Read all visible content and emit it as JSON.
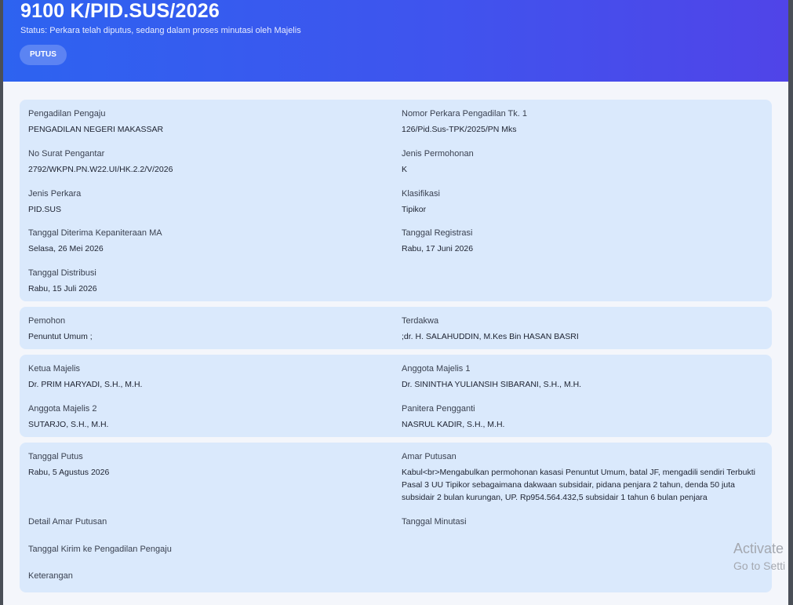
{
  "header": {
    "case_number": "9100 K/PID.SUS/2026",
    "status": "Status: Perkara telah diputus, sedang dalam proses minutasi oleh Majelis",
    "badge": "PUTUS"
  },
  "case_info": {
    "pengadilan_pengaju": {
      "label": "Pengadilan Pengaju",
      "value": "PENGADILAN NEGERI MAKASSAR"
    },
    "nomor_perkara_tk1": {
      "label": "Nomor Perkara Pengadilan Tk. 1",
      "value": "126/Pid.Sus-TPK/2025/PN Mks"
    },
    "no_surat_pengantar": {
      "label": "No Surat Pengantar",
      "value": "2792/WKPN.PN.W22.UI/HK.2.2/V/2026"
    },
    "jenis_permohonan": {
      "label": "Jenis Permohonan",
      "value": "K"
    },
    "jenis_perkara": {
      "label": "Jenis Perkara",
      "value": "PID.SUS"
    },
    "klasifikasi": {
      "label": "Klasifikasi",
      "value": "Tipikor"
    },
    "tanggal_diterima": {
      "label": "Tanggal Diterima Kepaniteraan MA",
      "value": "Selasa, 26 Mei 2026"
    },
    "tanggal_registrasi": {
      "label": "Tanggal Registrasi",
      "value": "Rabu, 17 Juni 2026"
    },
    "tanggal_distribusi": {
      "label": "Tanggal Distribusi",
      "value": "Rabu, 15 Juli 2026"
    }
  },
  "parties": {
    "pemohon": {
      "label": "Pemohon",
      "value": "Penuntut Umum ;"
    },
    "terdakwa": {
      "label": "Terdakwa",
      "value": ";dr. H. SALAHUDDIN, M.Kes Bin HASAN BASRI"
    }
  },
  "panel": {
    "ketua_majelis": {
      "label": "Ketua Majelis",
      "value": "Dr. PRIM HARYADI, S.H., M.H."
    },
    "anggota_majelis_1": {
      "label": "Anggota Majelis 1",
      "value": "Dr. SININTHA YULIANSIH SIBARANI, S.H., M.H."
    },
    "anggota_majelis_2": {
      "label": "Anggota Majelis 2",
      "value": "SUTARJO, S.H., M.H."
    },
    "panitera_pengganti": {
      "label": "Panitera Pengganti",
      "value": "NASRUL KADIR, S.H., M.H."
    }
  },
  "verdict": {
    "tanggal_putus": {
      "label": "Tanggal Putus",
      "value": "Rabu, 5 Agustus 2026"
    },
    "amar_putusan": {
      "label": "Amar Putusan",
      "value": "Kabul<br>Mengabulkan permohonan kasasi Penuntut Umum, batal JF, mengadili sendiri Terbukti Pasal 3 UU Tipikor sebagaimana dakwaan subsidair, pidana penjara 2 tahun, denda 50 juta subsidair 2 bulan kurungan, UP. Rp954.564.432,5 subsidair 1 tahun 6 bulan penjara"
    },
    "detail_amar_putusan": {
      "label": "Detail Amar Putusan",
      "value": ""
    },
    "tanggal_minutasi": {
      "label": "Tanggal Minutasi",
      "value": ""
    },
    "tanggal_kirim": {
      "label": "Tanggal Kirim ke Pengadilan Pengaju",
      "value": ""
    },
    "keterangan": {
      "label": "Keterangan",
      "value": ""
    }
  },
  "watermark": {
    "line1": "Activate",
    "line2": "Go to Setti"
  }
}
